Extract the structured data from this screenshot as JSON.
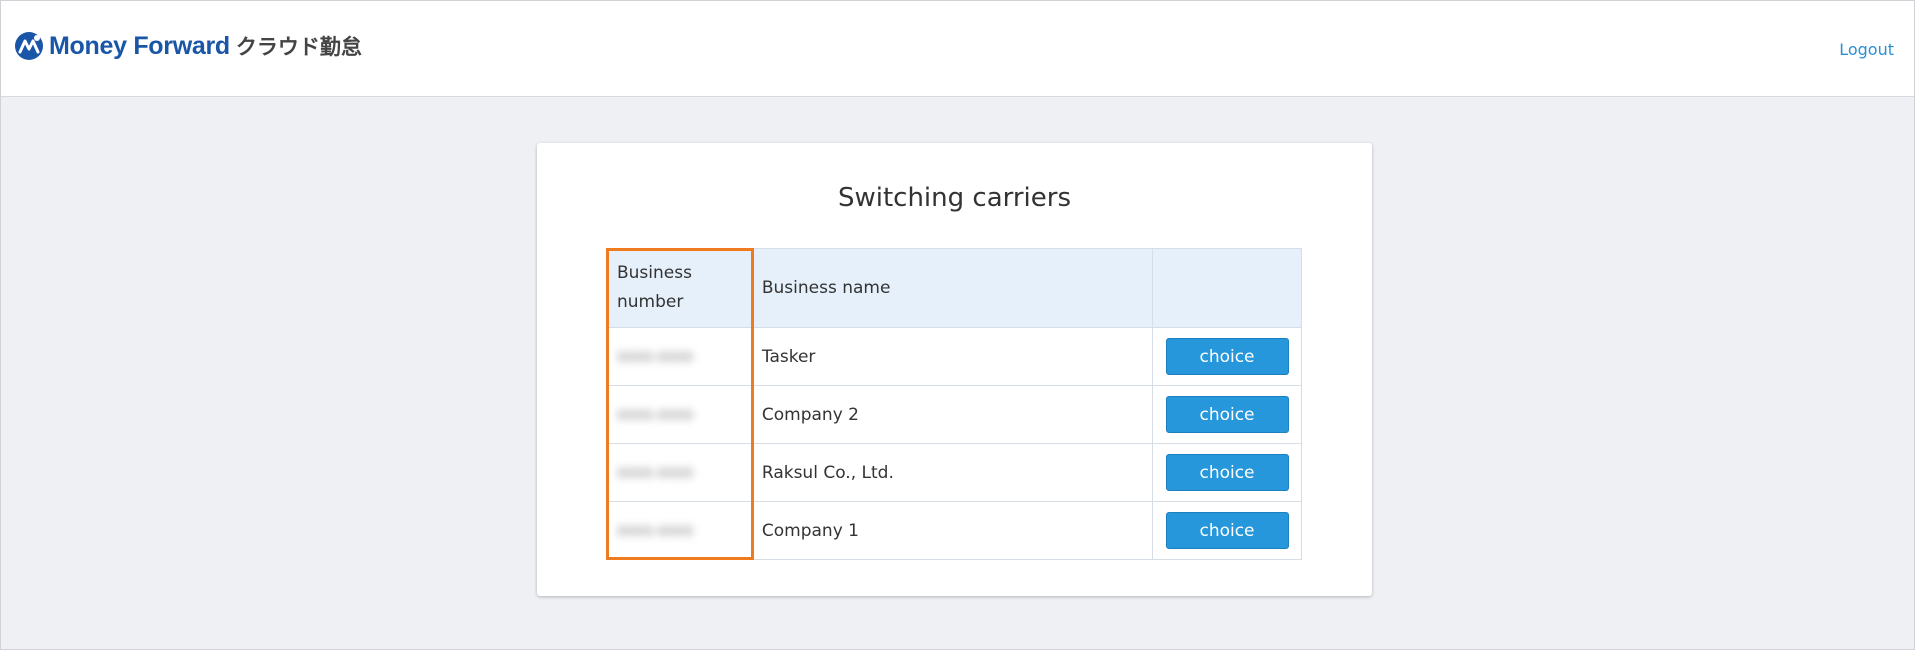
{
  "header": {
    "logo_text": "Money Forward",
    "logo_sub": "クラウド勤怠",
    "logout_label": "Logout"
  },
  "card": {
    "title": "Switching carriers"
  },
  "table": {
    "headers": {
      "business_number": "Business number",
      "business_name": "Business name",
      "choice": ""
    },
    "rows": [
      {
        "business_number": "0000-0000",
        "business_name": "Tasker",
        "choice_label": "choice"
      },
      {
        "business_number": "0000-0000",
        "business_name": "Company 2",
        "choice_label": "choice"
      },
      {
        "business_number": "0000-0000",
        "business_name": "Raksul Co., Ltd.",
        "choice_label": "choice"
      },
      {
        "business_number": "0000-0000",
        "business_name": "Company 1",
        "choice_label": "choice"
      }
    ]
  },
  "colors": {
    "brand": "#1a56a8",
    "accent_button": "#2797dc",
    "highlight": "#f07a1e",
    "table_header_bg": "#e5f0fb"
  }
}
